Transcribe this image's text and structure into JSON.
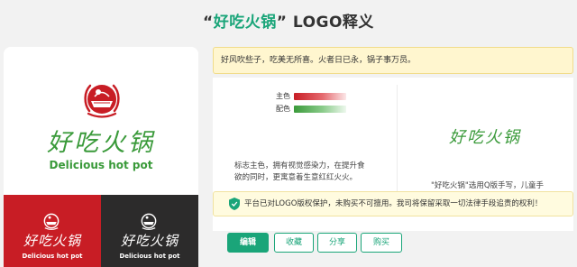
{
  "header": {
    "open_quote": "“",
    "brand": "好吃火锅",
    "close_quote": "”",
    "suffix": " LOGO释义"
  },
  "preview": {
    "logo_cn": "好吃火锅",
    "logo_en": "Delicious hot pot",
    "variants": [
      {
        "theme": "red",
        "cn": "好吃火锅",
        "en": "Delicious hot pot"
      },
      {
        "theme": "dark",
        "cn": "好吃火锅",
        "en": "Delicious hot pot"
      }
    ]
  },
  "slogan": "好风吹些子，吃美无所喜。火者日已永，锅子事万员。",
  "colors": {
    "primary_label": "主色",
    "secondary_label": "配色",
    "primary_hex": "#c81d25",
    "secondary_hex": "#3a9a3a",
    "description": "标志主色，拥有视觉感染力，在提升食欲的同时，更寓意着生意红红火火。"
  },
  "font": {
    "sample": "好吃火锅",
    "description": "\"好吃火锅\"选用Q版手写，儿童手写字体，更加自然，富有亲近感。"
  },
  "notice": "平台已对LOGO版权保护，未购买不可擅用。我司将保留采取一切法律手段追责的权利！",
  "actions": {
    "edit": "编辑",
    "favorite": "收藏",
    "share": "分享",
    "buy": "购买"
  },
  "theme": {
    "accent": "#1aa579",
    "red": "#c81d25",
    "dark": "#2c2b2b",
    "green": "#3a9a3a"
  }
}
